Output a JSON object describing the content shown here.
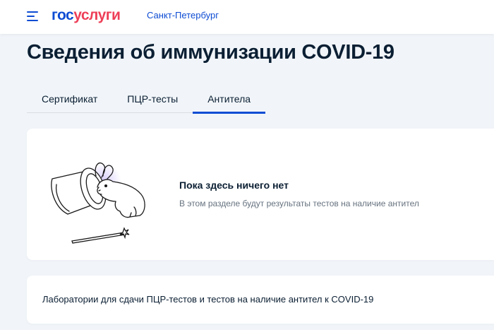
{
  "header": {
    "logo_part1": "гос",
    "logo_part2": "услуги",
    "region": "Санкт-Петербург"
  },
  "page": {
    "title": "Сведения об иммунизации COVID-19"
  },
  "tabs": [
    {
      "label": "Сертификат",
      "active": false
    },
    {
      "label": "ПЦР-тесты",
      "active": false
    },
    {
      "label": "Антитела",
      "active": true
    }
  ],
  "empty_state": {
    "title": "Пока здесь ничего нет",
    "description": "В этом разделе будут результаты тестов на наличие антител"
  },
  "labs_link": {
    "text": "Лаборатории для сдачи ПЦР-тестов и тестов на наличие антител к COVID-19"
  },
  "colors": {
    "brand_blue": "#0d4cd3",
    "brand_red": "#ee3f58",
    "background": "#f1f5f9",
    "text": "#0b1f33",
    "muted_text": "#66727f"
  },
  "icons": [
    "menu-icon",
    "magic-hat-rabbit-illustration",
    "magic-wand-icon"
  ]
}
